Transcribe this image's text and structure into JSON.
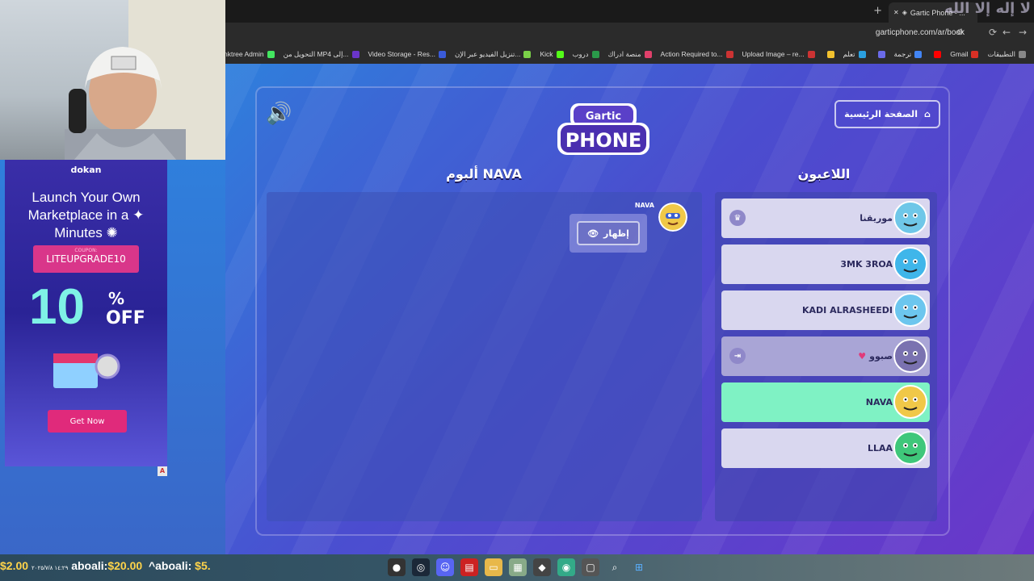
{
  "browser": {
    "tab_title": "Gartic Phone - ...",
    "watermark": "لا إله إلا الله",
    "url": "garticphone.com/ar/book",
    "bookmarks": [
      {
        "label": "التطبيقات",
        "color": "#888888"
      },
      {
        "label": "Gmail",
        "color": "#d93025"
      },
      {
        "label": "",
        "color": "#ff0000"
      },
      {
        "label": "ترجمة",
        "color": "#4285f4"
      },
      {
        "label": "",
        "color": "#6a6ae8"
      },
      {
        "label": "تعلم",
        "color": "#2aa0e0"
      },
      {
        "label": "",
        "color": "#f2c12e"
      },
      {
        "label": "Upload Image – re...",
        "color": "#c33"
      },
      {
        "label": "Action Required to...",
        "color": "#c33"
      },
      {
        "label": "منصة ادراك",
        "color": "#e0406a"
      },
      {
        "label": "دروب",
        "color": "#2a9a4a"
      },
      {
        "label": "Kick",
        "color": "#53fc18"
      },
      {
        "label": "تنزيل الفيديو عبر الإن...",
        "color": "#7bd148"
      },
      {
        "label": "Video Storage - Res...",
        "color": "#3a5bd9"
      },
      {
        "label": "التحويل من MP4 إلى...",
        "color": "#6a35c9"
      },
      {
        "label": "Linktree Admin",
        "color": "#43e660"
      }
    ]
  },
  "game": {
    "home_label": "الصفحة الرئيسية",
    "logo_top": "Gartic",
    "logo_bottom": "PHONE",
    "players_title": "اللاعبون",
    "album_title": "ألبوم NAVA",
    "message_author": "NAVA",
    "show_label": "إظهار",
    "players": [
      {
        "name": "موريقنا",
        "state": "owner",
        "color": "#6fc7e8"
      },
      {
        "name": "3MK 3ROA",
        "state": "normal",
        "color": "#3fb6ea"
      },
      {
        "name": "KADI ALRASHEEDI",
        "state": "normal",
        "color": "#6cc6ee"
      },
      {
        "name": "صبوو",
        "state": "disconnected",
        "color": "#7a72b0"
      },
      {
        "name": "NAVA",
        "state": "active",
        "color": "#f0c848"
      },
      {
        "name": "LLAA",
        "state": "normal",
        "color": "#3fc77a"
      }
    ]
  },
  "ad": {
    "brand": "dokan",
    "headline": "Launch Your Own Marketplace in a ✦ Minutes ✺",
    "coupon_label": "COUPON:",
    "coupon_code": "LITEUPGRADE10",
    "discount": "10",
    "discount_suffix": "OFF",
    "cta": "Get Now",
    "marker": "A"
  },
  "stream": {
    "ticker_prefix": "$2.00",
    "ticker_date": "١٤:٢٩ ٢٠٢٥/٧/٨",
    "donor1": "aboali:",
    "amount1": "$20.00",
    "donor2": "aboali:",
    "amount2": "$5."
  }
}
